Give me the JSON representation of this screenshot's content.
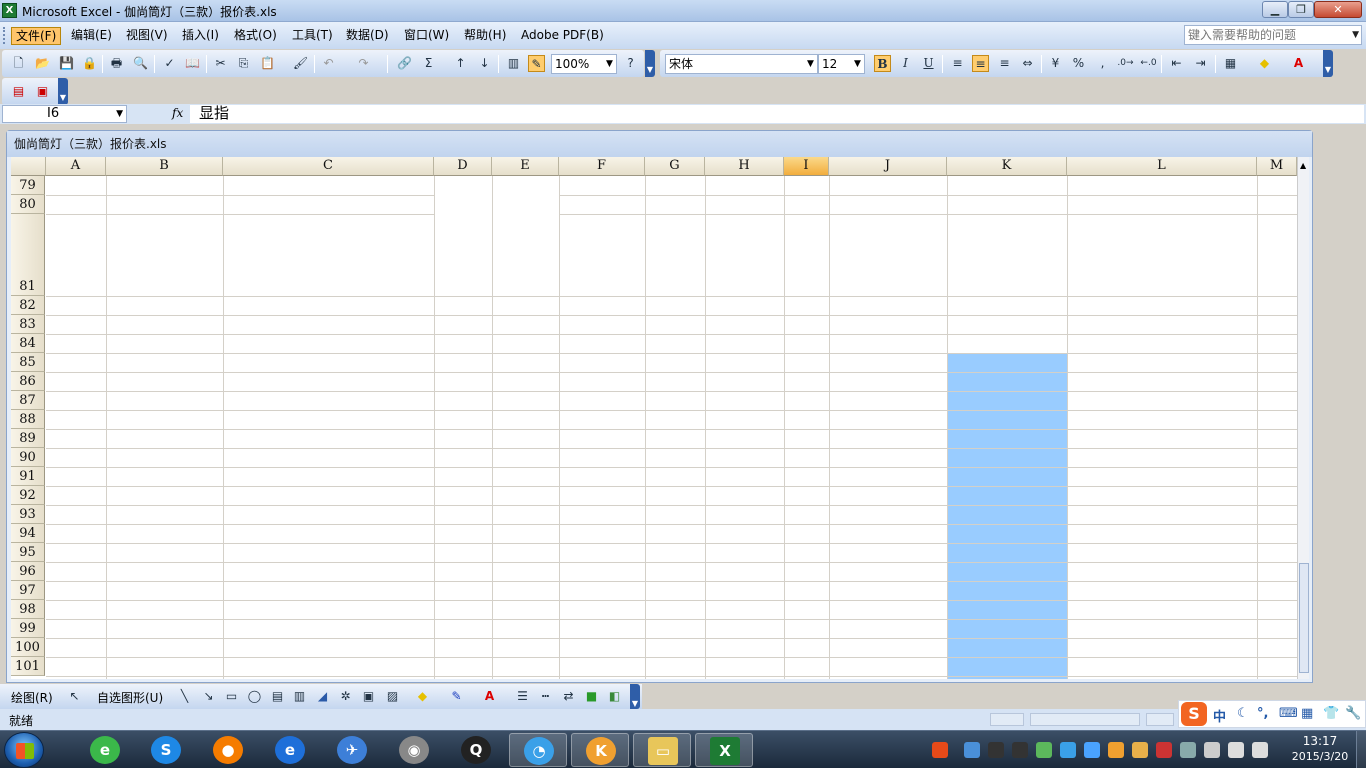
{
  "window": {
    "title": "Microsoft Excel - 伽尚筒灯（三款）报价表.xls",
    "app_icon_letter": "X",
    "buttons": [
      "minimize",
      "maximize",
      "close"
    ]
  },
  "menubar": {
    "items": [
      "文件(F)",
      "编辑(E)",
      "视图(V)",
      "插入(I)",
      "格式(O)",
      "工具(T)",
      "数据(D)",
      "窗口(W)",
      "帮助(H)",
      "Adobe PDF(B)"
    ],
    "active_index": 0,
    "help_placeholder": "键入需要帮助的问题"
  },
  "toolbar": {
    "zoom": "100%",
    "font": "宋体",
    "font_size": "12",
    "bold": "B",
    "italic": "I",
    "underline": "U",
    "percent": "%",
    "comma": ",",
    "sigma": "Σ"
  },
  "formulabar": {
    "cell_ref": "I6",
    "fx": "fx",
    "value": "显指"
  },
  "workbook": {
    "title": "伽尚筒灯（三款）报价表.xls",
    "columns": [
      "A",
      "B",
      "C",
      "D",
      "E",
      "F",
      "G",
      "H",
      "I",
      "J",
      "K",
      "L",
      "M"
    ],
    "selected_column": "I",
    "rows": [
      "79",
      "80",
      "81",
      "82",
      "83",
      "84",
      "85",
      "86",
      "87",
      "88",
      "89",
      "90",
      "91",
      "92",
      "93",
      "94",
      "95",
      "96",
      "97",
      "98",
      "99",
      "100",
      "101"
    ],
    "highlight_color": "#99ccff",
    "highlight_column": "K",
    "highlight_from_row": "85"
  },
  "drawbar": {
    "draw_label": "绘图(R)",
    "autoshapes_label": "自选图形(U)"
  },
  "statusbar": {
    "text": "就绪"
  },
  "ime": {
    "logo": "S",
    "mode": "中"
  },
  "taskbar": {
    "apps": [
      "360-browser",
      "sogou-browser",
      "orange-app",
      "internet-explorer",
      "flight-app",
      "film-reel",
      "qq",
      "bird-app",
      "fruit-app",
      "file-explorer",
      "excel"
    ],
    "active_app": "excel",
    "time": "13:17",
    "date": "2015/3/20"
  }
}
